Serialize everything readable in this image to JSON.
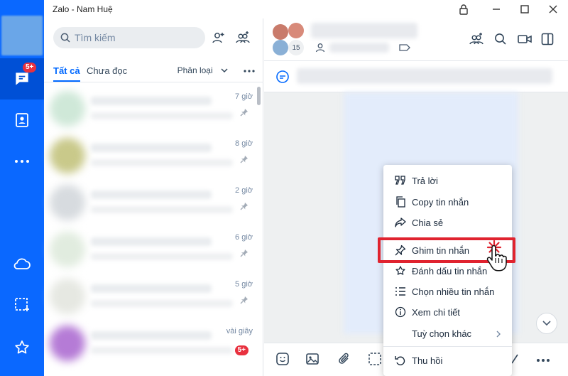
{
  "window": {
    "title": "Zalo - Nam Huệ"
  },
  "nav": {
    "messages_badge": "5+"
  },
  "search": {
    "placeholder": "Tìm kiếm"
  },
  "tabs": {
    "all": "Tất cả",
    "unread": "Chưa đọc",
    "filter": "Phân loại"
  },
  "conversations": [
    {
      "time": "7 giờ",
      "pinned": true
    },
    {
      "time": "8 giờ",
      "pinned": true
    },
    {
      "time": "2 giờ",
      "pinned": true
    },
    {
      "time": "6 giờ",
      "pinned": true
    },
    {
      "time": "5 giờ",
      "pinned": true
    },
    {
      "time": "vài giây",
      "badge": "5+"
    }
  ],
  "chat": {
    "member_count": "15"
  },
  "context_menu": {
    "items": [
      {
        "label": "Trả lời",
        "icon": "quote-icon"
      },
      {
        "label": "Copy tin nhắn",
        "icon": "copy-icon"
      },
      {
        "label": "Chia sẻ",
        "icon": "share-icon"
      },
      {
        "label": "Ghim tin nhắn",
        "icon": "pin-icon",
        "highlighted": true
      },
      {
        "label": "Đánh dấu tin nhắn",
        "icon": "star-icon"
      },
      {
        "label": "Chọn nhiều tin nhắn",
        "icon": "multi-select-icon"
      },
      {
        "label": "Xem chi tiết",
        "icon": "info-icon"
      },
      {
        "label": "Tuỳ chọn khác",
        "icon": "chevron-right-icon"
      },
      {
        "label": "Thu hồi",
        "icon": "undo-icon"
      }
    ]
  },
  "colors": {
    "brand": "#0068ff",
    "rail": "#0a68ff",
    "highlight": "#e0232f",
    "badge": "#e8313f"
  }
}
